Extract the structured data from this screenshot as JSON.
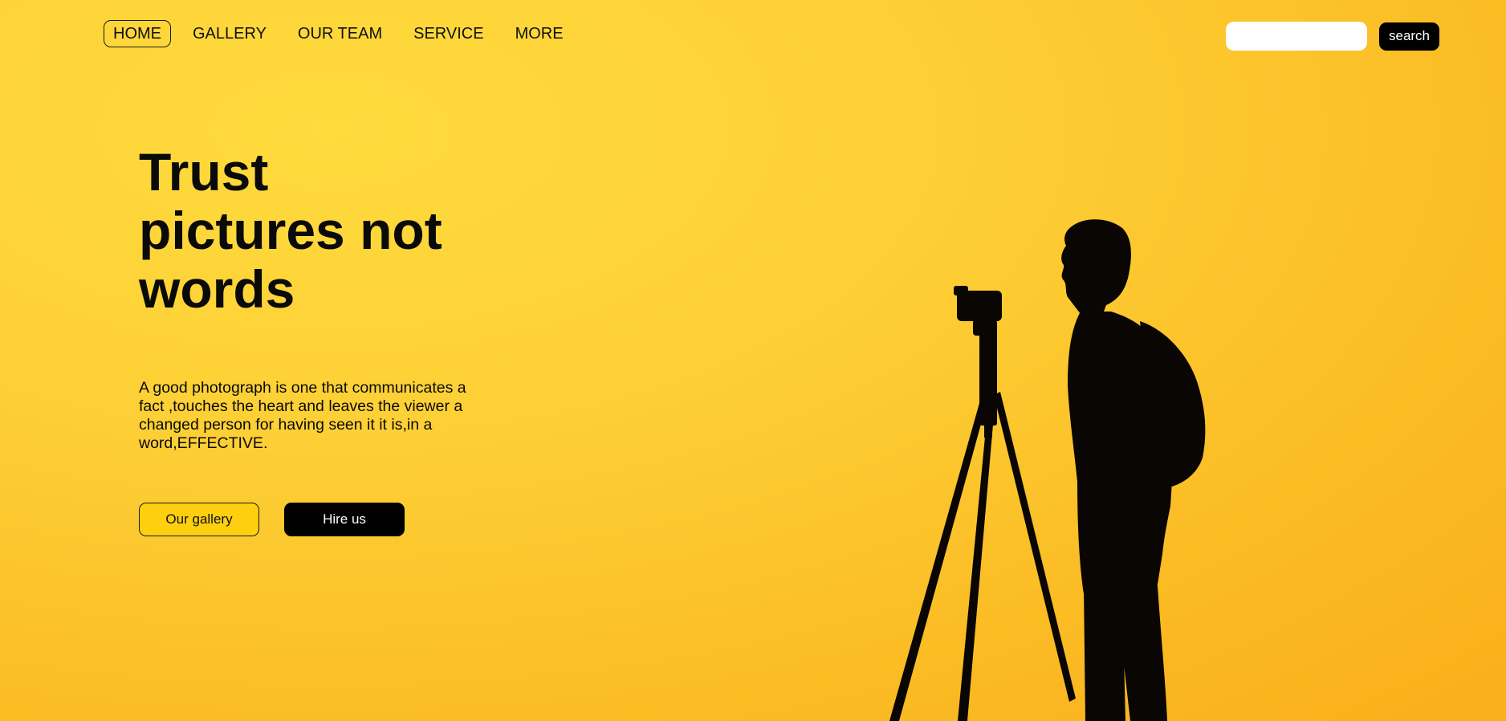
{
  "nav": {
    "items": [
      {
        "label": "HOME"
      },
      {
        "label": "GALLERY"
      },
      {
        "label": "OUR TEAM"
      },
      {
        "label": "SERVICE"
      },
      {
        "label": "MORE"
      }
    ],
    "active": "HOME"
  },
  "search": {
    "value": "",
    "placeholder": "",
    "button_label": "search"
  },
  "hero": {
    "title": "Trust pictures not words",
    "text": "A good photograph is one that communicates a fact ,touches the heart and leaves the viewer a changed person for having seen it it is,in a word,EFFECTIVE.",
    "buttons": {
      "gallery_label": "Our gallery",
      "hire_label": "Hire us"
    }
  },
  "image": {
    "subject": "photographer-with-tripod-silhouette"
  },
  "colors": {
    "background_light": "#ffdb3c",
    "background_dark": "#f9ae1a",
    "gallery_button": "#fecf0f",
    "hire_button": "#000000",
    "text": "#0a0a0a"
  }
}
